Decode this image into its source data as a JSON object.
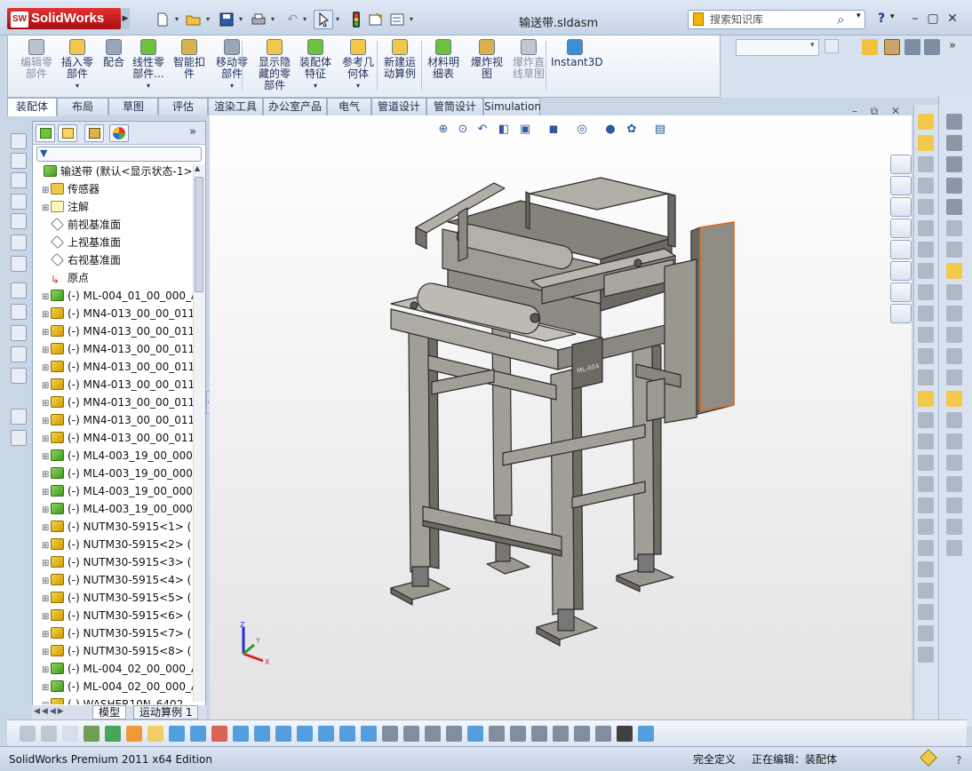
{
  "app": {
    "logo": "SolidWorks",
    "logo_badge": "SW",
    "doc_title": "输送带.sldasm"
  },
  "search": {
    "placeholder": "搜索知识库"
  },
  "title_buttons": {
    "help": "?"
  },
  "command_manager": {
    "items": [
      {
        "label": "编辑零部件",
        "lines": [
          "编辑零",
          "部件"
        ],
        "icon": "edit-component-icon",
        "enabled": false
      },
      {
        "label": "插入零部件",
        "lines": [
          "插入零",
          "部件"
        ],
        "icon": "insert-component-icon",
        "enabled": true
      },
      {
        "label": "配合",
        "lines": [
          "配合"
        ],
        "icon": "mate-icon",
        "enabled": true
      },
      {
        "label": "线性零部件...",
        "lines": [
          "线性零",
          "部件..."
        ],
        "icon": "linear-pattern-icon",
        "enabled": true
      },
      {
        "label": "智能扣件",
        "lines": [
          "智能扣",
          "件"
        ],
        "icon": "smart-fasteners-icon",
        "enabled": true
      },
      {
        "label": "移动零部件",
        "lines": [
          "移动零",
          "部件"
        ],
        "icon": "move-component-icon",
        "enabled": true
      },
      {
        "label": "显示隐藏的零部件",
        "lines": [
          "显示隐",
          "藏的零",
          "部件"
        ],
        "icon": "show-hidden-icon",
        "enabled": true
      },
      {
        "label": "装配体特征",
        "lines": [
          "装配体",
          "特征"
        ],
        "icon": "assembly-features-icon",
        "enabled": true
      },
      {
        "label": "参考几何体",
        "lines": [
          "参考几",
          "何体"
        ],
        "icon": "reference-geometry-icon",
        "enabled": true
      },
      {
        "label": "新建运动算例",
        "lines": [
          "新建运",
          "动算例"
        ],
        "icon": "new-motion-study-icon",
        "enabled": true
      },
      {
        "label": "材料明细表",
        "lines": [
          "材料明",
          "细表"
        ],
        "icon": "bom-icon",
        "enabled": true
      },
      {
        "label": "爆炸视图",
        "lines": [
          "爆炸视",
          "图"
        ],
        "icon": "exploded-view-icon",
        "enabled": true
      },
      {
        "label": "爆炸直线草图",
        "lines": [
          "爆炸直",
          "线草图"
        ],
        "icon": "explode-line-sketch-icon",
        "enabled": false
      },
      {
        "label": "Instant3D",
        "lines": [
          "Instant3D"
        ],
        "icon": "instant3d-icon",
        "enabled": true
      }
    ]
  },
  "tabs": [
    "装配体",
    "布局",
    "草图",
    "评估",
    "渲染工具",
    "办公室产品",
    "电气",
    "管道设计",
    "管筒设计",
    "Simulation"
  ],
  "active_tab": "装配体",
  "feature_tree": {
    "root": "输送带 (默认<显示状态-1>)",
    "items": [
      {
        "label": "传感器",
        "icon": "folder"
      },
      {
        "label": "注解",
        "icon": "ann"
      },
      {
        "label": "前视基准面",
        "icon": "plane"
      },
      {
        "label": "上视基准面",
        "icon": "plane"
      },
      {
        "label": "右视基准面",
        "icon": "plane"
      },
      {
        "label": "原点",
        "icon": "origin"
      },
      {
        "label": "(-) ML-004_01_00_000_A",
        "icon": "asm"
      },
      {
        "label": "(-) MN4-013_00_00_011",
        "icon": "part"
      },
      {
        "label": "(-) MN4-013_00_00_011",
        "icon": "part"
      },
      {
        "label": "(-) MN4-013_00_00_011",
        "icon": "part"
      },
      {
        "label": "(-) MN4-013_00_00_011",
        "icon": "part"
      },
      {
        "label": "(-) MN4-013_00_00_011",
        "icon": "part"
      },
      {
        "label": "(-) MN4-013_00_00_011",
        "icon": "part"
      },
      {
        "label": "(-) MN4-013_00_00_011",
        "icon": "part"
      },
      {
        "label": "(-) MN4-013_00_00_011",
        "icon": "part"
      },
      {
        "label": "(-) ML4-003_19_00_000_",
        "icon": "asm"
      },
      {
        "label": "(-) ML4-003_19_00_000_",
        "icon": "asm"
      },
      {
        "label": "(-) ML4-003_19_00_000_",
        "icon": "asm"
      },
      {
        "label": "(-) ML4-003_19_00_000_",
        "icon": "asm"
      },
      {
        "label": "(-) NUTM30-5915<1> (",
        "icon": "part"
      },
      {
        "label": "(-) NUTM30-5915<2> (",
        "icon": "part"
      },
      {
        "label": "(-) NUTM30-5915<3> (",
        "icon": "part"
      },
      {
        "label": "(-) NUTM30-5915<4> (",
        "icon": "part"
      },
      {
        "label": "(-) NUTM30-5915<5> (",
        "icon": "part"
      },
      {
        "label": "(-) NUTM30-5915<6> (",
        "icon": "part"
      },
      {
        "label": "(-) NUTM30-5915<7> (",
        "icon": "part"
      },
      {
        "label": "(-) NUTM30-5915<8> (",
        "icon": "part"
      },
      {
        "label": "(-) ML-004_02_00_000_A",
        "icon": "asm"
      },
      {
        "label": "(-) ML-004_02_00_000_A",
        "icon": "asm"
      },
      {
        "label": "(-) WASHER10N_6402",
        "icon": "part"
      }
    ]
  },
  "bottom_tabs": [
    "模型",
    "运动算例 1"
  ],
  "model_label": "ML-004",
  "status": {
    "product": "SolidWorks Premium 2011 x64 Edition",
    "definition": "完全定义",
    "editing": "正在编辑：装配体"
  }
}
